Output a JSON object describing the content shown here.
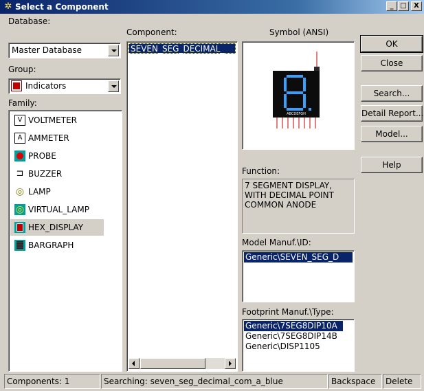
{
  "window": {
    "title": "Select a Component",
    "min": "_",
    "max": "□",
    "close": "X"
  },
  "database": {
    "label": "Database:",
    "value": "Master Database"
  },
  "group": {
    "label": "Group:",
    "value": "Indicators"
  },
  "family": {
    "label": "Family:",
    "items": [
      {
        "label": "VOLTMETER",
        "icon": "voltmeter-icon"
      },
      {
        "label": "AMMETER",
        "icon": "ammeter-icon"
      },
      {
        "label": "PROBE",
        "icon": "probe-icon"
      },
      {
        "label": "BUZZER",
        "icon": "buzzer-icon"
      },
      {
        "label": "LAMP",
        "icon": "lamp-icon"
      },
      {
        "label": "VIRTUAL_LAMP",
        "icon": "virtual-lamp-icon"
      },
      {
        "label": "HEX_DISPLAY",
        "icon": "hex-display-icon"
      },
      {
        "label": "BARGRAPH",
        "icon": "bargraph-icon"
      }
    ],
    "selected": "HEX_DISPLAY"
  },
  "component": {
    "label": "Component:",
    "items": [
      "SEVEN_SEG_DECIMAL_"
    ]
  },
  "symbol": {
    "label": "Symbol (ANSI)",
    "segment_text": "ABCDEFGH",
    "color": "#3aa0ff"
  },
  "function": {
    "label": "Function:",
    "text": "7 SEGMENT DISPLAY,\nWITH DECIMAL POINT\nCOMMON ANODE"
  },
  "model": {
    "label": "Model Manuf.\\ID:",
    "items": [
      "Generic\\SEVEN_SEG_D"
    ]
  },
  "footprint": {
    "label": "Footprint Manuf.\\Type:",
    "items": [
      "Generic\\7SEG8DIP10A",
      "Generic\\7SEG8DIP14B",
      "Generic\\DISP1105"
    ]
  },
  "buttons": {
    "ok": "OK",
    "close": "Close",
    "search": "Search...",
    "detail": "Detail Report...",
    "model": "Model...",
    "help": "Help"
  },
  "status": {
    "count": "Components: 1",
    "searching": "Searching: seven_seg_decimal_com_a_blue",
    "backspace": "Backspace",
    "delete": "Delete"
  }
}
